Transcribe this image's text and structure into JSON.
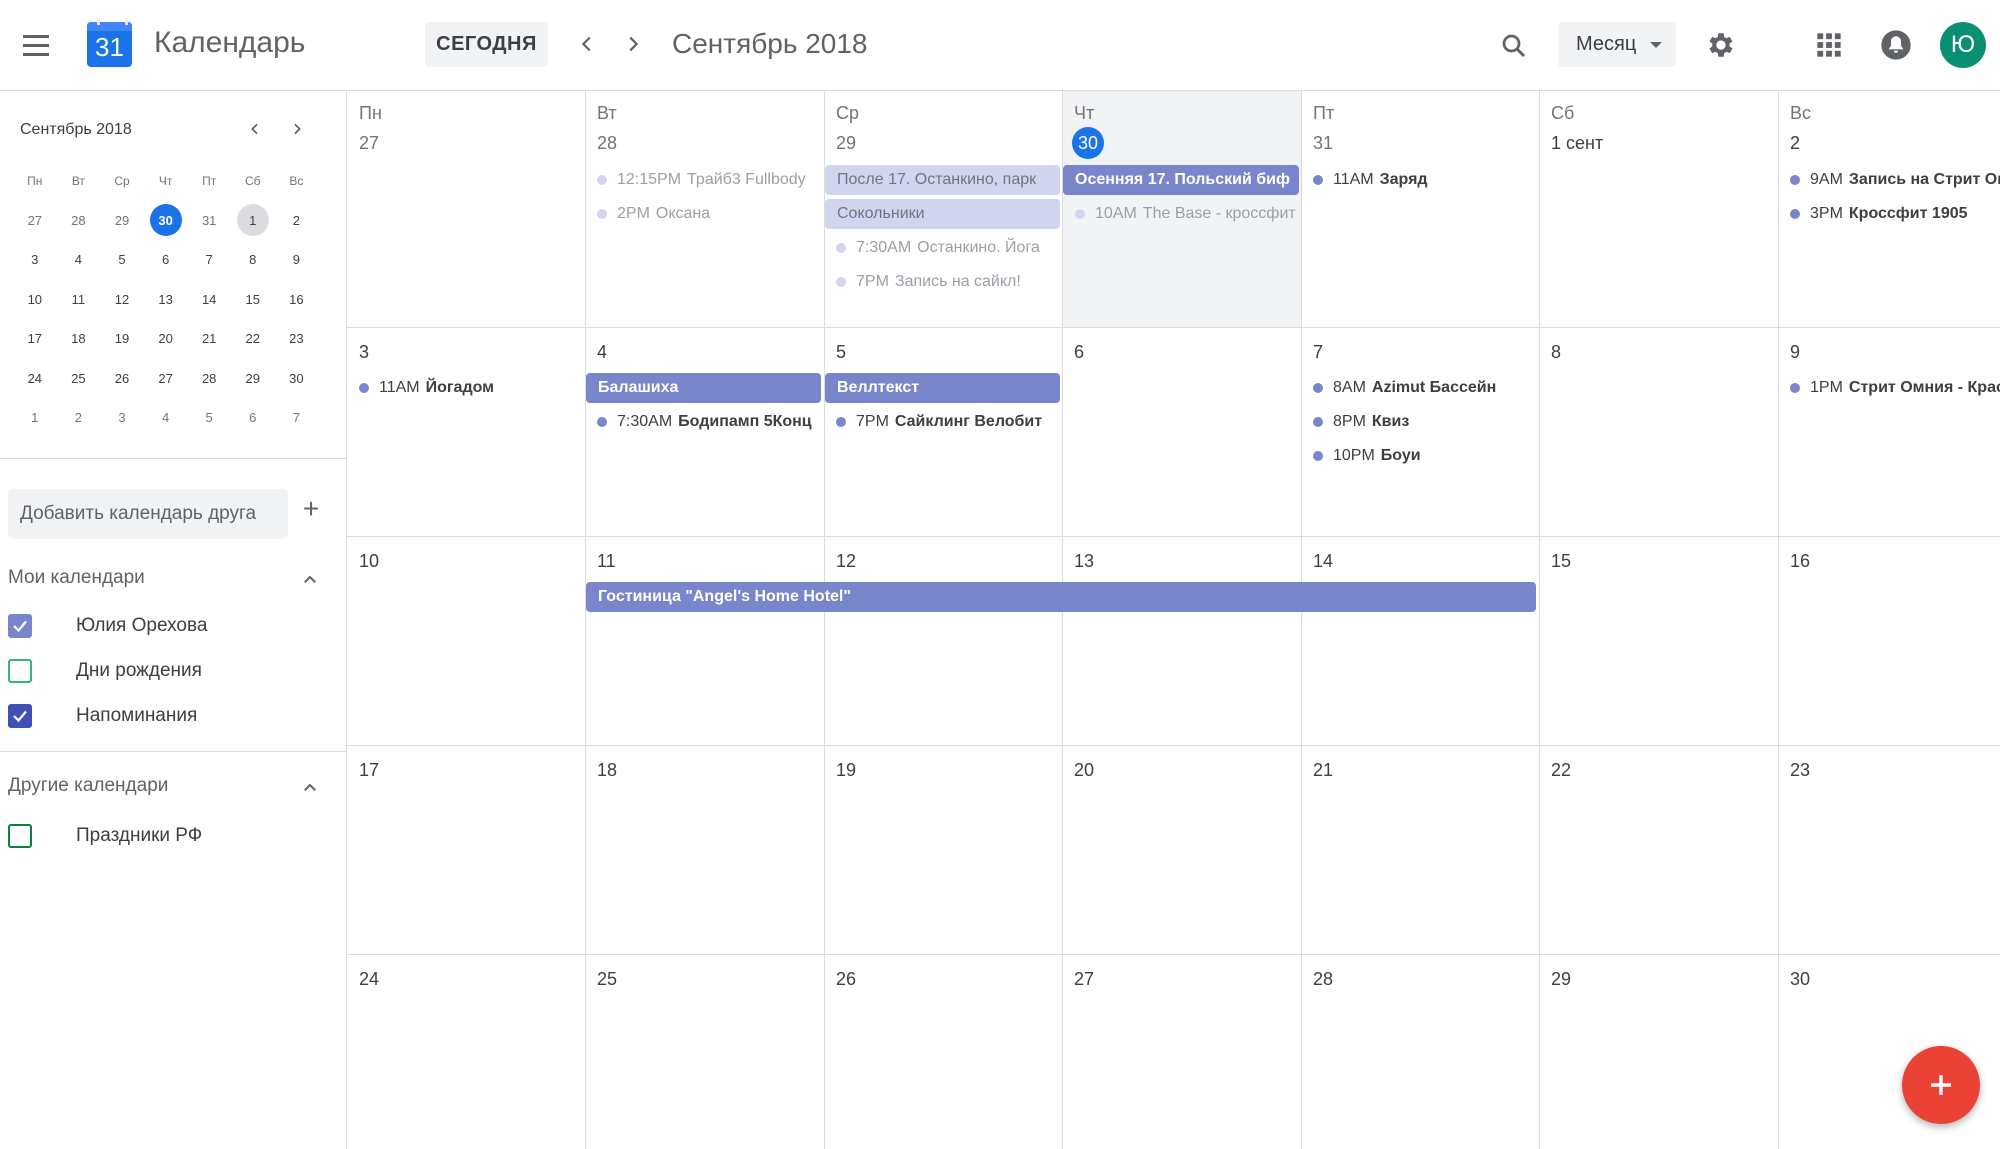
{
  "app": {
    "title": "Календарь",
    "logo_day": "31"
  },
  "toolbar": {
    "today_label": "СЕГОДНЯ",
    "period": "Сентябрь 2018",
    "view": "Месяц",
    "avatar_letter": "Ю"
  },
  "mini": {
    "title": "Сентябрь 2018",
    "dow": [
      "Пн",
      "Вт",
      "Ср",
      "Чт",
      "Пт",
      "Сб",
      "Вс"
    ],
    "weeks": [
      [
        "27",
        "28",
        "29",
        "30",
        "31",
        "1",
        "2"
      ],
      [
        "3",
        "4",
        "5",
        "6",
        "7",
        "8",
        "9"
      ],
      [
        "10",
        "11",
        "12",
        "13",
        "14",
        "15",
        "16"
      ],
      [
        "17",
        "18",
        "19",
        "20",
        "21",
        "22",
        "23"
      ],
      [
        "24",
        "25",
        "26",
        "27",
        "28",
        "29",
        "30"
      ],
      [
        "1",
        "2",
        "3",
        "4",
        "5",
        "6",
        "7"
      ]
    ]
  },
  "sidebar": {
    "add_friend": "Добавить календарь друга",
    "my_calendars_title": "Мои календари",
    "my_calendars": [
      {
        "label": "Юлия Орехова",
        "checked": true,
        "color": "#7986cb"
      },
      {
        "label": "Дни рождения",
        "checked": false,
        "color": "#33b679"
      },
      {
        "label": "Напоминания",
        "checked": true,
        "color": "#3f51b5"
      }
    ],
    "other_calendars_title": "Другие календари",
    "other_calendars": [
      {
        "label": "Праздники РФ",
        "checked": false,
        "color": "#0b8043"
      }
    ]
  },
  "month": {
    "dow": [
      "Пн",
      "Вт",
      "Ср",
      "Чт",
      "Пт",
      "Сб",
      "Вс"
    ],
    "weeks": [
      [
        "27",
        "28",
        "29",
        "30",
        "31",
        "1 сент",
        "2"
      ],
      [
        "3",
        "4",
        "5",
        "6",
        "7",
        "8",
        "9"
      ],
      [
        "10",
        "11",
        "12",
        "13",
        "14",
        "15",
        "16"
      ],
      [
        "17",
        "18",
        "19",
        "20",
        "21",
        "22",
        "23"
      ],
      [
        "24",
        "25",
        "26",
        "27",
        "28",
        "29",
        "30"
      ]
    ],
    "events": {
      "tue28_1": {
        "time": "12:15PM",
        "title": "Трайб3 Fullbody"
      },
      "tue28_2": {
        "time": "2PM",
        "title": "Оксана"
      },
      "wed29_chip1": "После 17. Останкино, парк",
      "wed29_chip2": "Сокольники",
      "wed29_1": {
        "time": "7:30AM",
        "title": "Останкино. Йога"
      },
      "wed29_2": {
        "time": "7PM",
        "title": "Запись на сайкл!"
      },
      "thu30_chip": "Осенняя 17. Польский биф",
      "thu30_1": {
        "time": "10AM",
        "title": "The Base - кроссфит"
      },
      "fri31_1": {
        "time": "11AM",
        "title": "Заряд"
      },
      "sun2_1": {
        "time": "9AM",
        "title": "Запись на Стрит Ом"
      },
      "sun2_2": {
        "time": "3PM",
        "title": "Кроссфит 1905"
      },
      "mon3_1": {
        "time": "11AM",
        "title": "Йогадом"
      },
      "tue4_chip": "Балашиха",
      "tue4_1": {
        "time": "7:30AM",
        "title": "Бодипамп 5Конц"
      },
      "wed5_chip": "Веллтекст",
      "wed5_1": {
        "time": "7PM",
        "title": "Сайклинг Велобит"
      },
      "fri7_1": {
        "time": "8AM",
        "title": "Azimut Бассейн"
      },
      "fri7_2": {
        "time": "8PM",
        "title": "Квиз"
      },
      "fri7_3": {
        "time": "10PM",
        "title": "Боуи"
      },
      "sun9_1": {
        "time": "1PM",
        "title": "Стрит Омния - Крас"
      },
      "hotel_chip": "Гостиница \"Angel's Home Hotel\""
    }
  }
}
